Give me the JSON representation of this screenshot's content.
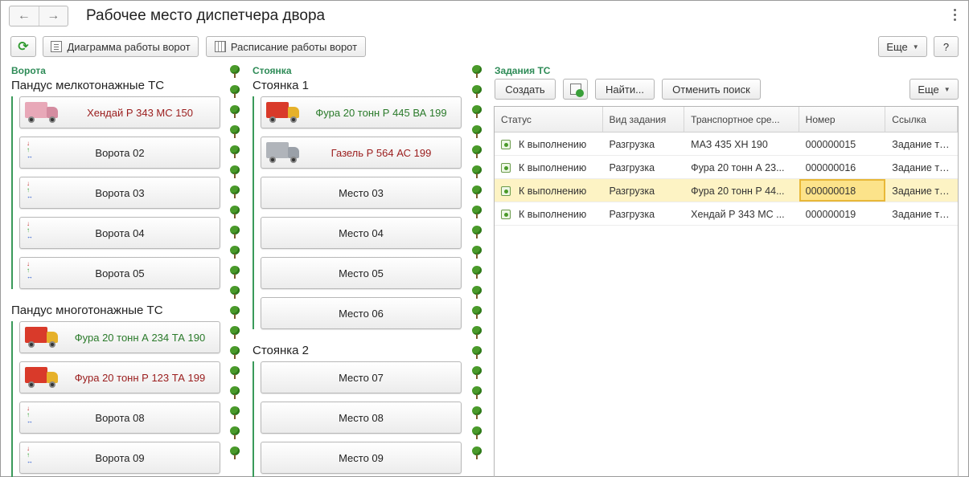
{
  "header": {
    "title": "Рабочее место диспетчера двора",
    "back_icon": "←",
    "forward_icon": "→"
  },
  "toolbar": {
    "refresh_icon": "⟳",
    "diagram_label": "Диаграмма работы ворот",
    "schedule_label": "Расписание работы ворот",
    "more_label": "Еще",
    "help_label": "?"
  },
  "gates": {
    "heading": "Ворота",
    "groups": [
      {
        "title": "Пандус мелкотонажные ТС",
        "tiles": [
          {
            "label": "Хендай Р 343 МС 150",
            "vehicle": "pink-truck-icon"
          },
          {
            "label": "Ворота 02"
          },
          {
            "label": "Ворота 03"
          },
          {
            "label": "Ворота 04"
          },
          {
            "label": "Ворота 05"
          }
        ]
      },
      {
        "title": "Пандус многотонажные ТС",
        "tiles": [
          {
            "label": "Фура 20 тонн А 234 ТА 190",
            "vehicle": "red-truck-icon"
          },
          {
            "label": "Фура 20 тонн  Р 123 ТА 199",
            "vehicle": "red-truck-icon"
          },
          {
            "label": "Ворота 08"
          },
          {
            "label": "Ворота 09"
          }
        ]
      }
    ],
    "arrow_glyphs": {
      "down": "↓",
      "up": "↑",
      "lr": "↔"
    }
  },
  "parking": {
    "heading": "Стоянка",
    "groups": [
      {
        "title": "Стоянка 1",
        "tiles": [
          {
            "label": "Фура 20 тонн Р 445 ВА 199",
            "vehicle": "red-truck-icon"
          },
          {
            "label": "Газель Р 564 АС 199",
            "vehicle": "grey-van-icon"
          },
          {
            "label": "Место 03"
          },
          {
            "label": "Место 04"
          },
          {
            "label": "Место 05"
          },
          {
            "label": "Место 06"
          }
        ]
      },
      {
        "title": "Стоянка 2",
        "tiles": [
          {
            "label": "Место 07"
          },
          {
            "label": "Место 08"
          },
          {
            "label": "Место 09"
          }
        ]
      }
    ]
  },
  "tasks": {
    "heading": "Задания ТС",
    "create_label": "Создать",
    "find_label": "Найти...",
    "cancel_search_label": "Отменить поиск",
    "more_label": "Еще",
    "columns": [
      "Статус",
      "Вид задания",
      "Транспортное сре...",
      "Номер",
      "Ссылка"
    ],
    "rows": [
      {
        "status": "К выполнению",
        "kind": "Разгрузка",
        "vehicle": "МАЗ 435 ХН 190",
        "number": "000000015",
        "link": "Задание тран"
      },
      {
        "status": "К выполнению",
        "kind": "Разгрузка",
        "vehicle": "Фура 20 тонн А 23...",
        "number": "000000016",
        "link": "Задание тран"
      },
      {
        "status": "К выполнению",
        "kind": "Разгрузка",
        "vehicle": "Фура 20 тонн Р 44...",
        "number": "000000018",
        "link": "Задание тран"
      },
      {
        "status": "К выполнению",
        "kind": "Разгрузка",
        "vehicle": "Хендай Р 343 МС ...",
        "number": "000000019",
        "link": "Задание тран"
      }
    ],
    "selected_row": 2
  }
}
